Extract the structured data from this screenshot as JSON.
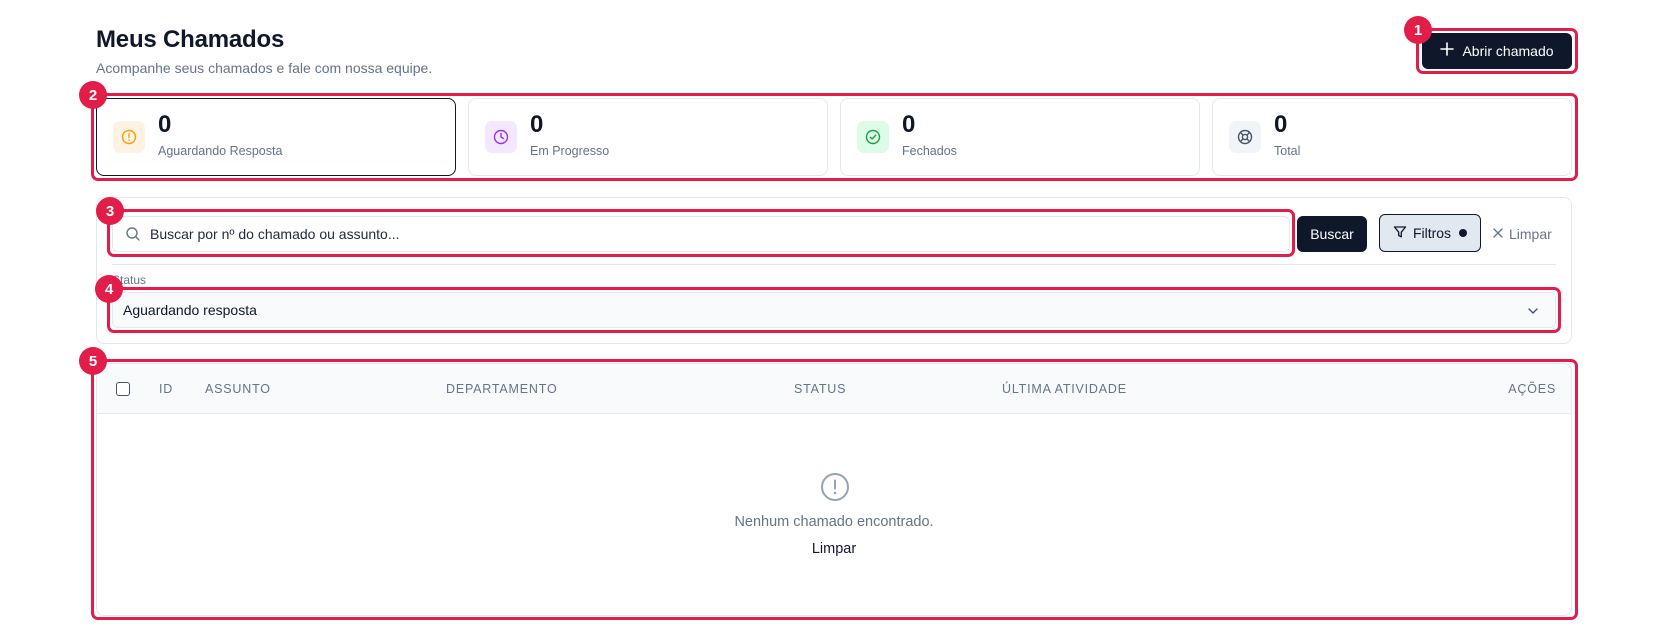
{
  "header": {
    "title": "Meus Chamados",
    "subtitle": "Acompanhe seus chamados e fale com nossa equipe.",
    "open_button_label": "Abrir chamado",
    "open_button_icon": "plus-icon"
  },
  "stats": [
    {
      "value": "0",
      "label": "Aguardando Resposta",
      "icon": "alert-circle-icon",
      "color": "#f59e0b",
      "bg": "#fef3e2",
      "active": true
    },
    {
      "value": "0",
      "label": "Em Progresso",
      "icon": "clock-icon",
      "color": "#9333ea",
      "bg": "#f3e8ff",
      "active": false
    },
    {
      "value": "0",
      "label": "Fechados",
      "icon": "check-circle-icon",
      "color": "#16a34a",
      "bg": "#dcfce7",
      "active": false
    },
    {
      "value": "0",
      "label": "Total",
      "icon": "life-buoy-icon",
      "color": "#475569",
      "bg": "#f1f5f9",
      "active": false
    }
  ],
  "filters": {
    "search_placeholder": "Buscar por nº do chamado ou assunto...",
    "search_value": "",
    "search_button": "Buscar",
    "filters_button": "Filtros",
    "clear_button": "Limpar",
    "status_label": "Status",
    "status_selected": "Aguardando resposta"
  },
  "table": {
    "columns": [
      "ID",
      "ASSUNTO",
      "DEPARTAMENTO",
      "STATUS",
      "ÚLTIMA ATIVIDADE",
      "AÇÕES"
    ],
    "rows": [],
    "empty_message": "Nenhum chamado encontrado.",
    "empty_clear": "Limpar"
  },
  "annotations": [
    "1",
    "2",
    "3",
    "4",
    "5"
  ],
  "colors": {
    "primary": "#0f172a",
    "annotation": "#e11d48",
    "muted": "#64748b",
    "border": "#e2e8f0"
  }
}
